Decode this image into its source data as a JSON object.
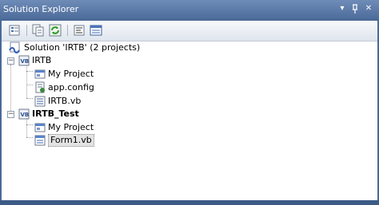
{
  "window": {
    "title": "Solution Explorer",
    "dropdown_glyph": "▾",
    "pin_glyph": "ᛘ",
    "close_glyph": "✕"
  },
  "tree": {
    "solution": {
      "label": "Solution 'IRTB' (2 projects)"
    },
    "projects": [
      {
        "label": "IRTB",
        "expander": "−",
        "children": [
          {
            "label": "My Project"
          },
          {
            "label": "app.config"
          },
          {
            "label": "IRTB.vb"
          }
        ]
      },
      {
        "label": "IRTB_Test",
        "expander": "−",
        "children": [
          {
            "label": "My Project"
          },
          {
            "label": "Form1.vb"
          }
        ]
      }
    ]
  },
  "colors": {
    "title_bar": "#5b7aa8",
    "panel_border": "#3c5b87",
    "selection": "#e3e3e3"
  }
}
